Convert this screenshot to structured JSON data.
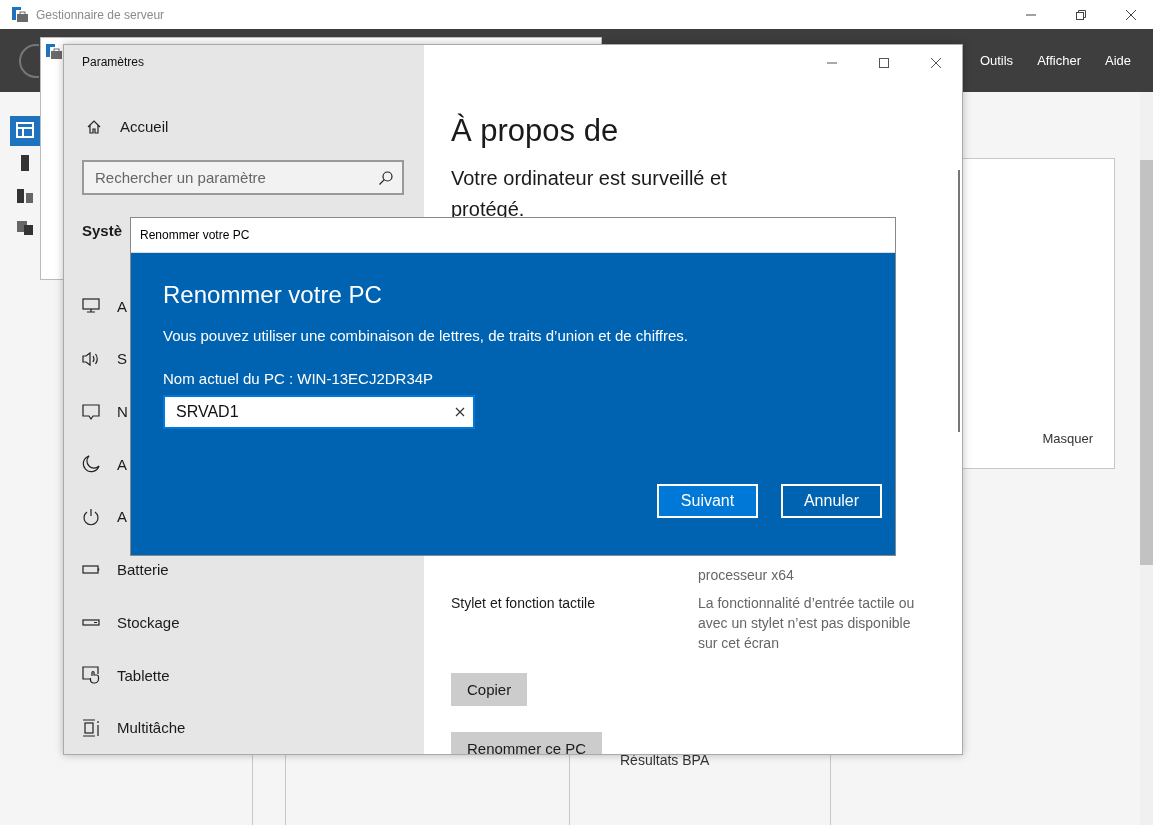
{
  "server_manager": {
    "title": "Gestionnaire de serveur",
    "menu": [
      "Outils",
      "Afficher",
      "Aide"
    ],
    "nav": [
      {
        "selected": true
      },
      {
        "selected": false
      },
      {
        "selected": false
      },
      {
        "selected": false
      }
    ],
    "panel": {
      "link": "Masquer"
    },
    "tile": {
      "title": "Résultats BPA"
    }
  },
  "settings": {
    "title": "Paramètres",
    "home": "Accueil",
    "search": {
      "placeholder": "Rechercher un paramètre"
    },
    "section": "Systè",
    "items": [
      "A",
      "S",
      "N",
      "A",
      "A",
      "Batterie",
      "Stockage",
      "Tablette",
      "Multitâche"
    ],
    "heading": "À propos de",
    "status": "Votre ordinateur est surveillé et protégé.",
    "specs": [
      {
        "value": "processeur x64"
      },
      {
        "label": "Stylet et fonction tactile",
        "value": "La fonctionnalité d’entrée tactile ou avec un stylet n’est pas disponible sur cet écran"
      }
    ],
    "buttons": [
      "Copier",
      "Renommer ce PC"
    ]
  },
  "dialog": {
    "title": "Renommer votre PC",
    "heading": "Renommer votre PC",
    "description": "Vous pouvez utiliser une combinaison de lettres, de traits d’union et de chiffres.",
    "current_name": "Nom actuel du PC : WIN-13ECJ2DR34P",
    "name_field": {
      "value": "SRVAD1"
    },
    "buttons": [
      {
        "label": "Suivant",
        "kind": "primary"
      },
      {
        "label": "Annuler",
        "kind": "secondary"
      }
    ]
  }
}
